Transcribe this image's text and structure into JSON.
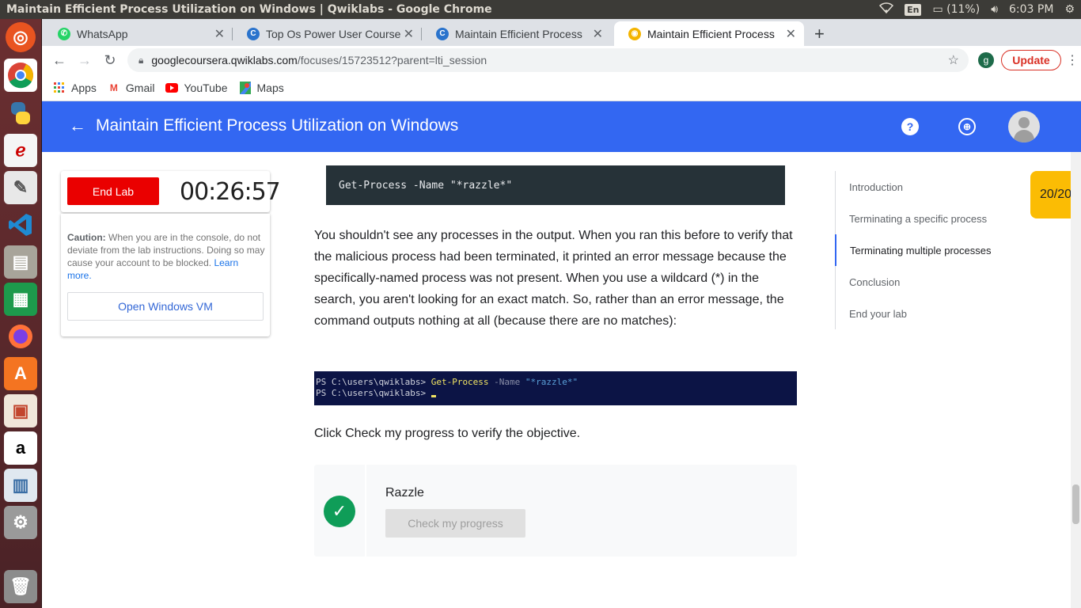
{
  "os": {
    "window_title": "Maintain Efficient Process Utilization on Windows | Qwiklabs - Google Chrome",
    "keyboard": "En",
    "battery": "(11%)",
    "time": "6:03 PM"
  },
  "tabs": [
    {
      "label": "WhatsApp",
      "favicon": "whatsapp-icon",
      "color": "#25d366"
    },
    {
      "label": "Top Os Power User Course",
      "favicon": "coursera-icon",
      "color": "#2a73cc"
    },
    {
      "label": "Maintain Efficient Process",
      "favicon": "coursera-icon",
      "color": "#2a73cc"
    },
    {
      "label": "Maintain Efficient Process",
      "favicon": "qwiklabs-icon",
      "color": "#f4b400"
    }
  ],
  "toolbar": {
    "url_host": "googlecoursera.qwiklabs.com",
    "url_path": "/focuses/15723512?parent=lti_session",
    "profile_initial": "g",
    "update_label": "Update"
  },
  "bookmarks": [
    {
      "label": "Apps",
      "icon": "apps-grid-icon"
    },
    {
      "label": "Gmail",
      "icon": "gmail-icon"
    },
    {
      "label": "YouTube",
      "icon": "youtube-icon"
    },
    {
      "label": "Maps",
      "icon": "maps-icon"
    }
  ],
  "header": {
    "title": "Maintain Efficient Process Utilization on Windows",
    "accent": "#3367f2"
  },
  "lab": {
    "end_label": "End Lab",
    "timer": "00:26:57",
    "caution_bold": "Caution:",
    "caution_text": " When you are in the console, do not deviate from the lab instructions. Doing so may cause your account to be blocked. ",
    "learn_more": "Learn more.",
    "open_vm": "Open Windows VM"
  },
  "main": {
    "code": "Get-Process -Name \"*razzle*\"",
    "paragraph": "You shouldn't see any processes in the output. When you ran this before to verify that the malicious process had been terminated, it printed an error message because the specifically-named process was not present. When you use a wildcard (*) in the search, you aren't looking for an exact match. So, rather than an error message, the command outputs nothing at all (because there are no matches):",
    "terminal": {
      "prompt": "PS C:\\users\\qwiklabs> ",
      "cmd": "Get-Process",
      "param": " -Name ",
      "arg": "\"*razzle*\""
    },
    "click_note": "Click Check my progress to verify the objective.",
    "progress_title": "Razzle",
    "check_label": "Check my progress"
  },
  "toc": [
    {
      "label": "Introduction",
      "active": false
    },
    {
      "label": "Terminating a specific process",
      "active": false
    },
    {
      "label": "Terminating multiple processes",
      "active": true
    },
    {
      "label": "Conclusion",
      "active": false
    },
    {
      "label": "End your lab",
      "active": false
    }
  ],
  "score": "20/20"
}
